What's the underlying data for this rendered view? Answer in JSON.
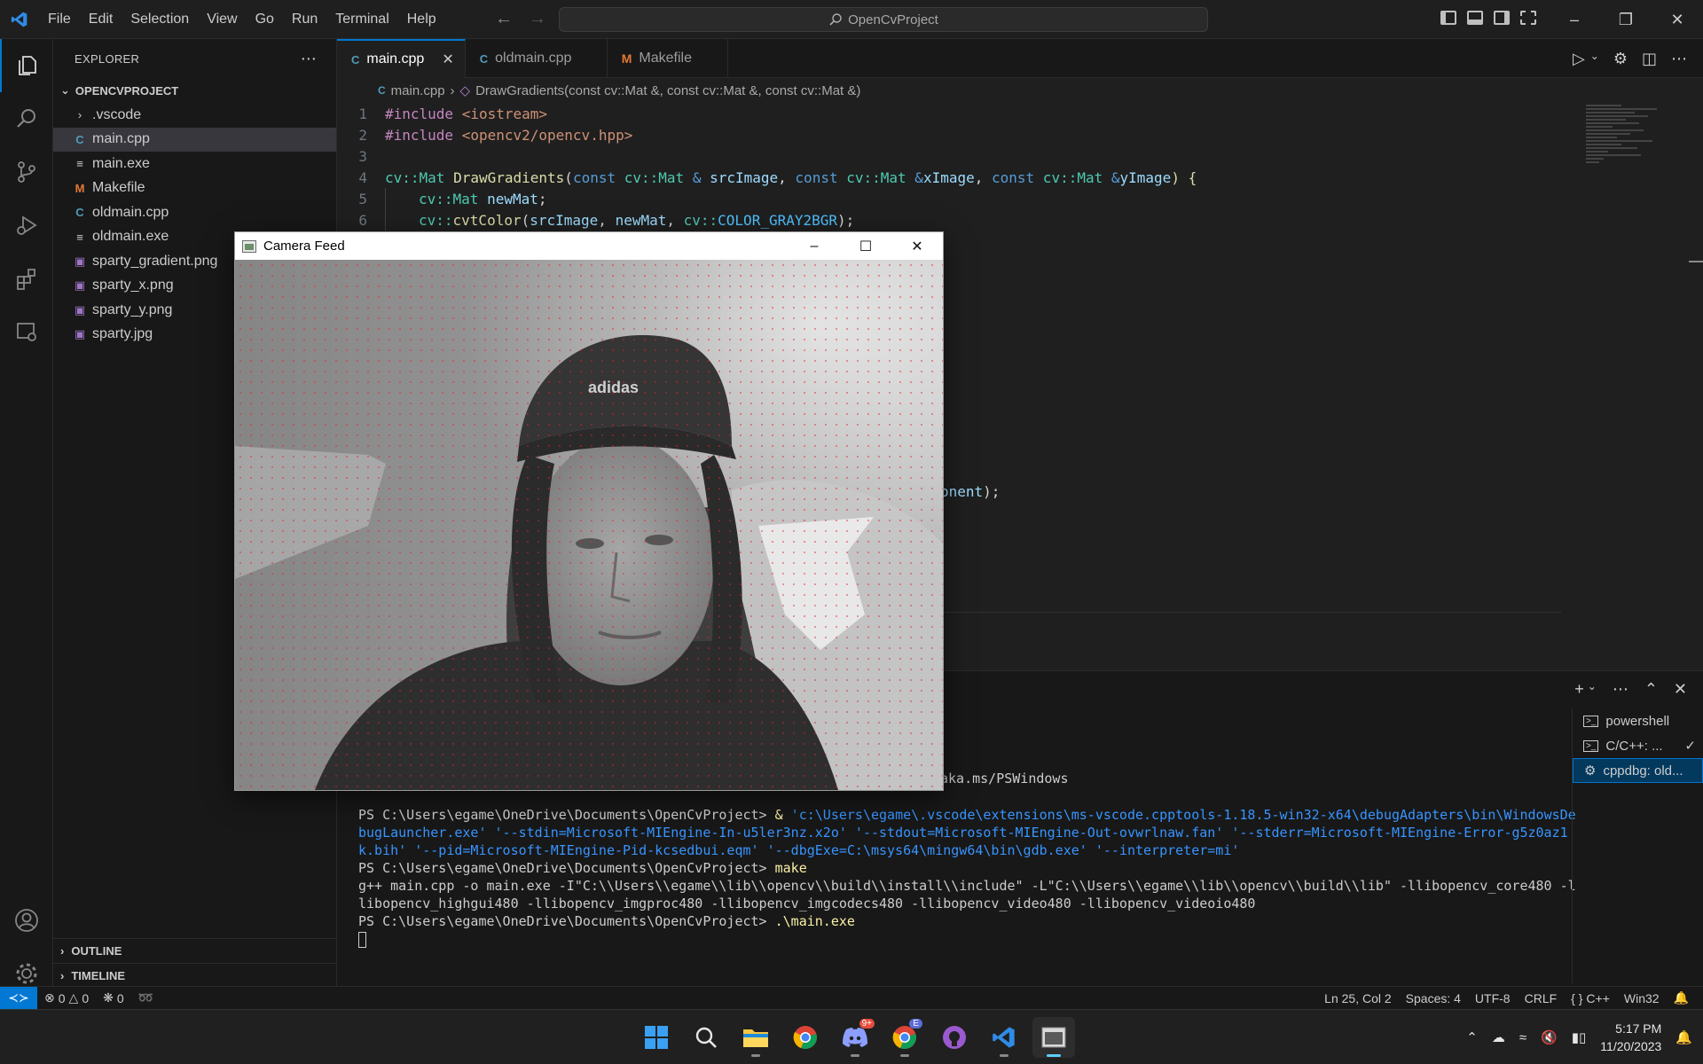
{
  "menu": [
    "File",
    "Edit",
    "Selection",
    "View",
    "Go",
    "Run",
    "Terminal",
    "Help"
  ],
  "search": {
    "text": "OpenCvProject"
  },
  "sidebar": {
    "title": "EXPLORER",
    "project": "OPENCVPROJECT",
    "items": [
      {
        "name": ".vscode",
        "icon": "chevron-right-icon"
      },
      {
        "name": "main.cpp",
        "icon": "cpp-file-icon",
        "selected": true
      },
      {
        "name": "main.exe",
        "icon": "text-file-icon"
      },
      {
        "name": "Makefile",
        "icon": "makefile-icon"
      },
      {
        "name": "oldmain.cpp",
        "icon": "cpp-file-icon"
      },
      {
        "name": "oldmain.exe",
        "icon": "text-file-icon"
      },
      {
        "name": "sparty_gradient.png",
        "icon": "image-file-icon"
      },
      {
        "name": "sparty_x.png",
        "icon": "image-file-icon"
      },
      {
        "name": "sparty_y.png",
        "icon": "image-file-icon"
      },
      {
        "name": "sparty.jpg",
        "icon": "image-file-icon"
      }
    ],
    "outline": "OUTLINE",
    "timeline": "TIMELINE"
  },
  "tabs": [
    "main.cpp",
    "oldmain.cpp",
    "Makefile"
  ],
  "breadcrumb": {
    "file": "main.cpp",
    "symbol": "DrawGradients(const cv::Mat &, const cv::Mat &, const cv::Mat &)"
  },
  "code": {
    "line_numbers": [
      "1",
      "2",
      "3",
      "4",
      "5",
      "6"
    ],
    "l1_directive": "#include",
    "l1_header": " <iostream>",
    "l2_directive": "#include",
    "l2_header": " <opencv2/opencv.hpp>",
    "l4": {
      "t1": "cv::",
      "t2": "Mat",
      "t3": " DrawGradients",
      "t4": "(",
      "t5": "const",
      "t6": " cv::",
      "t7": "Mat",
      "t8": " & ",
      "t9": "srcImage",
      "t10": ", ",
      "t11": "const",
      "t12": " cv::",
      "t13": "Mat",
      "t14": " &",
      "t15": "xImage",
      "t16": ", ",
      "t17": "const",
      "t18": " cv::",
      "t19": "Mat",
      "t20": " &",
      "t21": "yImage",
      "t22": ") {"
    },
    "l5": {
      "t1": "cv::",
      "t2": "Mat",
      "t3": " newMat",
      "t4": ";"
    },
    "l6": {
      "t1": "cv::",
      "t2": "cvtColor",
      "t3": "(",
      "t4": "srcImage",
      "t5": ", ",
      "t6": "newMat",
      "t7": ", ",
      "t8": "cv::",
      "t9": "COLOR_GRAY2BGR",
      "t10": ");"
    },
    "partial": {
      "name": "onent",
      "end": ");"
    }
  },
  "terminal": {
    "overflow": "aka.ms/PSWindows",
    "prompt1": "PS C:\\Users\\egame\\OneDrive\\Documents\\OpenCvProject>",
    "amp": " & ",
    "launcher": "'c:\\Users\\egame\\.vscode\\extensions\\ms-vscode.cpptools-1.18.5-win32-x64\\debugAdapters\\bin\\WindowsDebugLauncher.exe'",
    "args": " '--stdin=Microsoft-MIEngine-In-u5ler3nz.x2o' '--stdout=Microsoft-MIEngine-Out-ovwrlnaw.fan' '--stderr=Microsoft-MIEngine-Error-g5z0az1k.bih' '--pid=Microsoft-MIEngine-Pid-kcsedbui.eqm' '--dbgExe=C:\\msys64\\mingw64\\bin\\gdb.exe' '--interpreter=mi'",
    "prompt2": "PS C:\\Users\\egame\\OneDrive\\Documents\\OpenCvProject>",
    "cmd2": " make",
    "gpp": "g++ main.cpp -o main.exe -I\"C:\\\\Users\\\\egame\\\\lib\\\\opencv\\\\build\\\\install\\\\include\" -L\"C:\\\\Users\\\\egame\\\\lib\\\\opencv\\\\build\\\\lib\" -llibopencv_core480 -llibopencv_highgui480 -llibopencv_imgproc480 -llibopencv_imgcodecs480 -llibopencv_video480 -llibopencv_videoio480",
    "prompt3": "PS C:\\Users\\egame\\OneDrive\\Documents\\OpenCvProject>",
    "cmd3": " .\\main.exe",
    "instances": [
      "powershell",
      "C/C++: ...",
      "cppdbg: old..."
    ]
  },
  "statusbar": {
    "errors": "0",
    "warnings": "0",
    "ports": "0",
    "position": "Ln 25, Col 2",
    "spaces": "Spaces: 4",
    "encoding": "UTF-8",
    "eol": "CRLF",
    "language": "C++",
    "platform": "Win32"
  },
  "camera": {
    "title": "Camera Feed",
    "logo_text": "adidas"
  },
  "taskbar": {
    "time": "5:17 PM",
    "date": "11/20/2023",
    "discord_badge": "9+",
    "chrome_badge": "E"
  },
  "colors": {
    "accent": "#0078d4",
    "editor_bg": "#1f1f1f",
    "sidebar_bg": "#181818"
  }
}
